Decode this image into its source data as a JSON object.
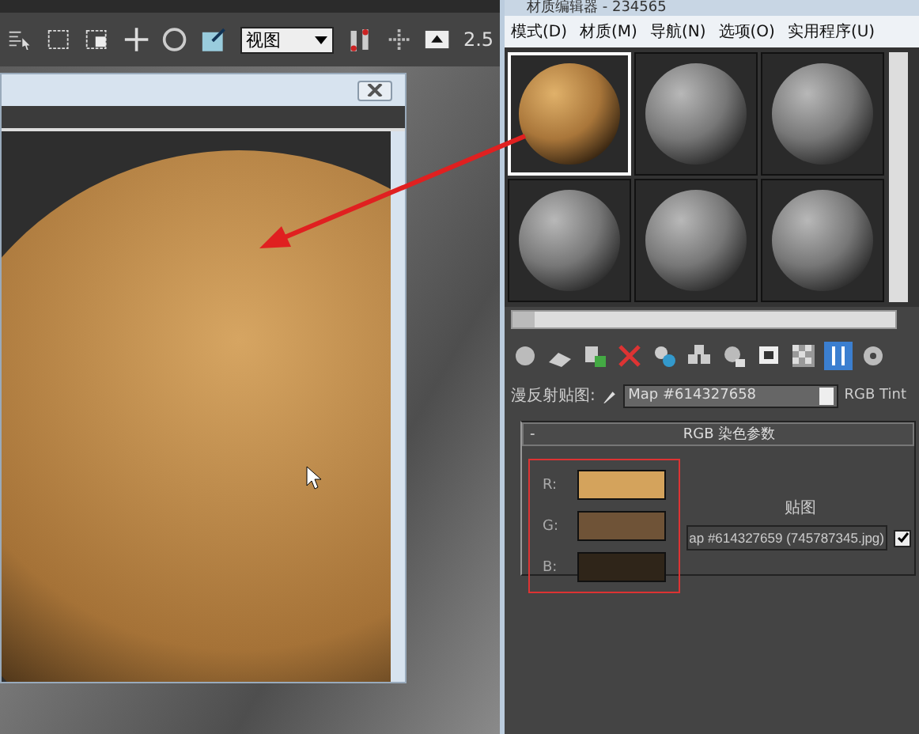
{
  "main_toolbar": {
    "view_dropdown": "视图",
    "spinner_value": "2.5"
  },
  "material_editor": {
    "title": "材质编辑器 - 234565",
    "menu": [
      "模式(D)",
      "材质(M)",
      "导航(N)",
      "选项(O)",
      "实用程序(U)"
    ],
    "sample_slots": [
      {
        "kind": "textured",
        "selected": true
      },
      {
        "kind": "blank",
        "selected": false
      },
      {
        "kind": "blank",
        "selected": false
      },
      {
        "kind": "blank",
        "selected": false
      },
      {
        "kind": "blank",
        "selected": false
      },
      {
        "kind": "blank",
        "selected": false
      }
    ],
    "map_row": {
      "label": "漫反射贴图:",
      "map_name": "Map #614327658",
      "map_type": "RGB Tint"
    },
    "rollout": {
      "collapse_sign": "-",
      "title": "RGB 染色参数",
      "channels": [
        {
          "label": "R:",
          "color": "#d4a35c"
        },
        {
          "label": "G:",
          "color": "#6f5337"
        },
        {
          "label": "B:",
          "color": "#2f2519"
        }
      ],
      "map_heading": "贴图",
      "map_button": "ap #614327659 (745787345.jpg)",
      "map_enabled": true
    }
  }
}
